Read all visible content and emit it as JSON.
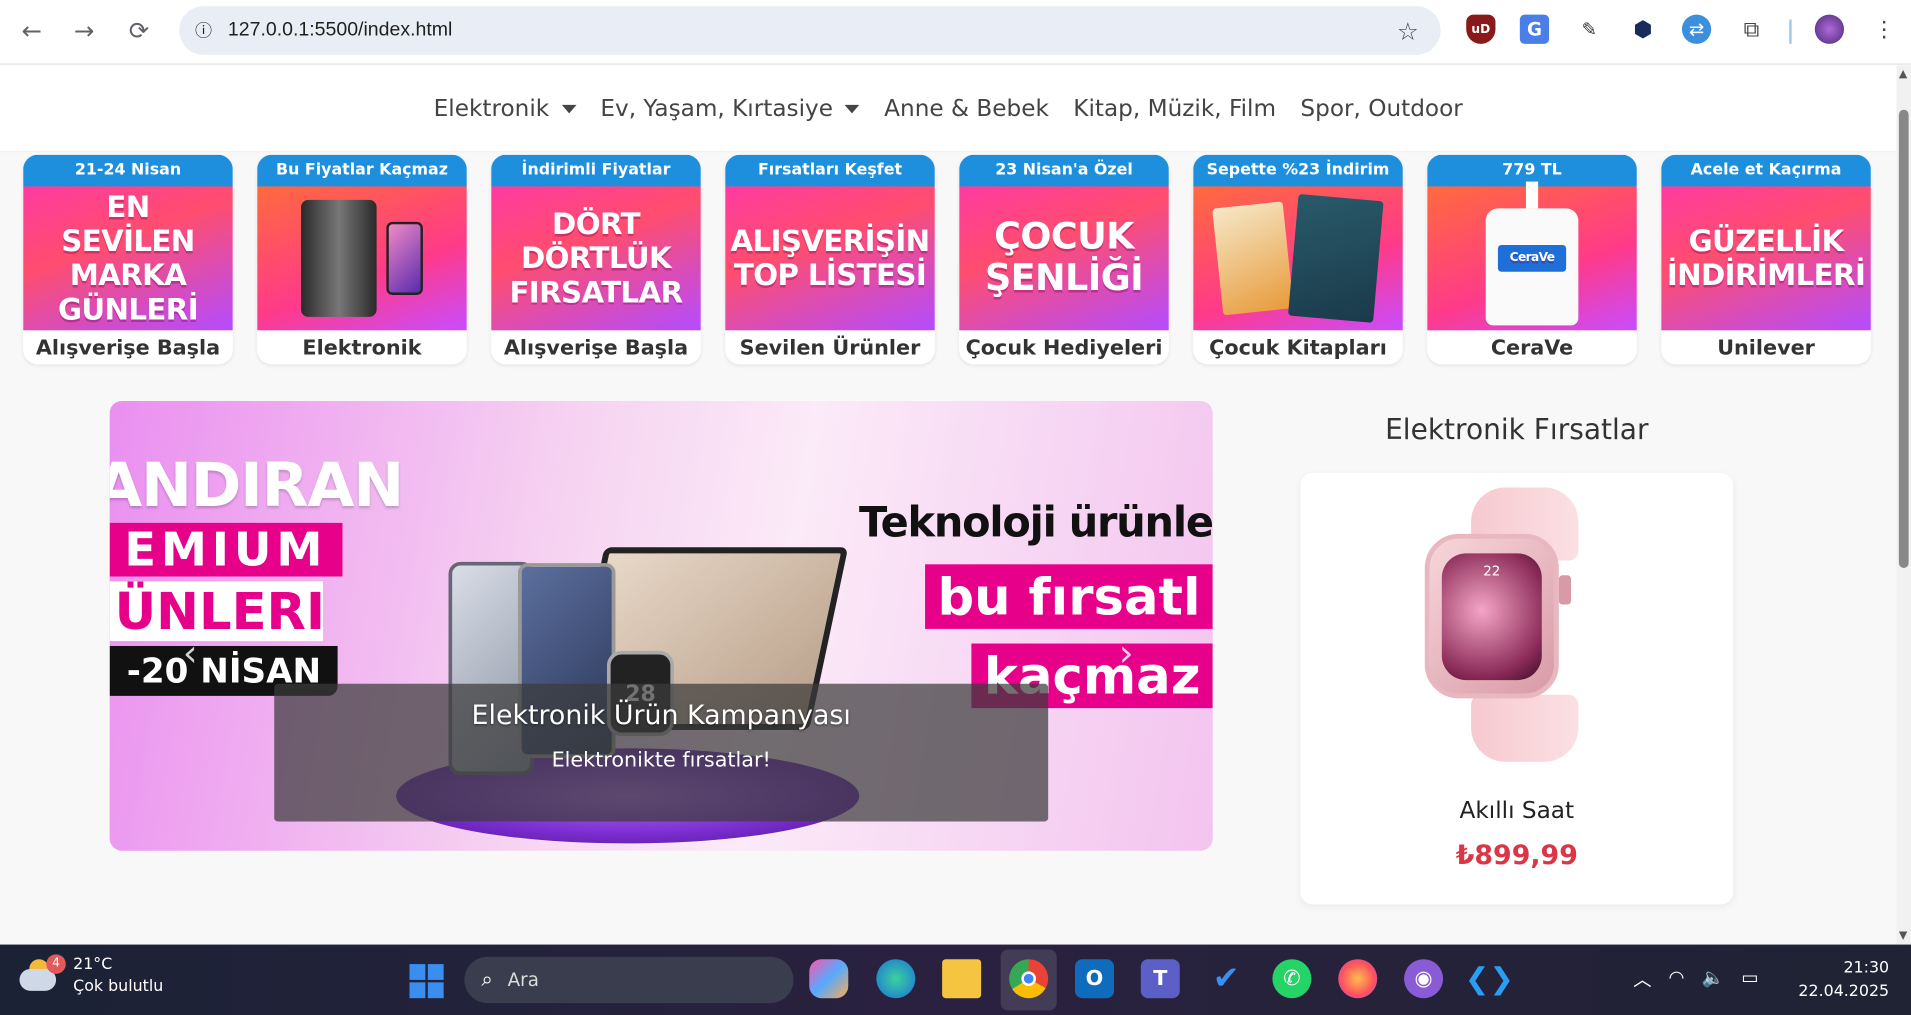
{
  "browser": {
    "url": "127.0.0.1:5500/index.html",
    "back_icon": "←",
    "forward_icon": "→",
    "reload_icon": "⟳",
    "info_icon": "ⓘ",
    "star_icon": "☆"
  },
  "nav": {
    "items": [
      {
        "label": "Elektronik",
        "dropdown": true
      },
      {
        "label": "Ev, Yaşam, Kırtasiye",
        "dropdown": true
      },
      {
        "label": "Anne & Bebek",
        "dropdown": false
      },
      {
        "label": "Kitap, Müzik, Film",
        "dropdown": false
      },
      {
        "label": "Spor, Outdoor",
        "dropdown": false
      }
    ]
  },
  "tiles": [
    {
      "top": "21-24 Nisan",
      "image_text": "EN SEVİLEN MARKA GÜNLERİ",
      "bottom": "Alışverişe Başla"
    },
    {
      "top": "Bu Fiyatlar Kaçmaz",
      "image_text": "",
      "bottom": "Elektronik"
    },
    {
      "top": "İndirimli Fiyatlar",
      "image_text": "DÖRT DÖRTLÜK FIRSATLAR",
      "bottom": "Alışverişe Başla"
    },
    {
      "top": "Fırsatları Keşfet",
      "image_text": "ALIŞVERİŞİN TOP LİSTESİ",
      "bottom": "Sevilen Ürünler"
    },
    {
      "top": "23 Nisan'a Özel",
      "image_text": "ÇOCUK ŞENLİĞİ",
      "bottom": "Çocuk Hediyeleri"
    },
    {
      "top": "Sepette %23 İndirim",
      "image_text": "",
      "bottom": "Çocuk Kitapları"
    },
    {
      "top": "779 TL",
      "image_text": "",
      "bottom": "CeraVe"
    },
    {
      "top": "Acele et Kaçırma",
      "image_text": "GÜZELLİK İNDİRİMLERİ",
      "bottom": "Unilever"
    }
  ],
  "carousel": {
    "banner_left": [
      "ANDIRAN",
      "EMIUM",
      "ÜNLERI",
      "-20 NİSAN"
    ],
    "banner_right": [
      "Teknoloji ürünle",
      "bu fırsatl",
      "kaçmaz"
    ],
    "watch_number": "28",
    "caption_title": "Elektronik Ürün Kampanyası",
    "caption_text": "Elektronikte fırsatlar!",
    "prev_icon": "‹",
    "next_icon": "›"
  },
  "deals": {
    "title": "Elektronik Fırsatlar",
    "product_name": "Akıllı Saat",
    "price": "₺899,99",
    "watch_time": "22"
  },
  "taskbar": {
    "weather_temp": "21°C",
    "weather_desc": "Çok bulutlu",
    "weather_badge": "4",
    "search_placeholder": "Ara",
    "time": "21:30",
    "date": "22.04.2025"
  },
  "colors": {
    "accent_blue": "#1e8fdc",
    "brand_pink": "#e6008a",
    "price_red": "#dc3545"
  }
}
